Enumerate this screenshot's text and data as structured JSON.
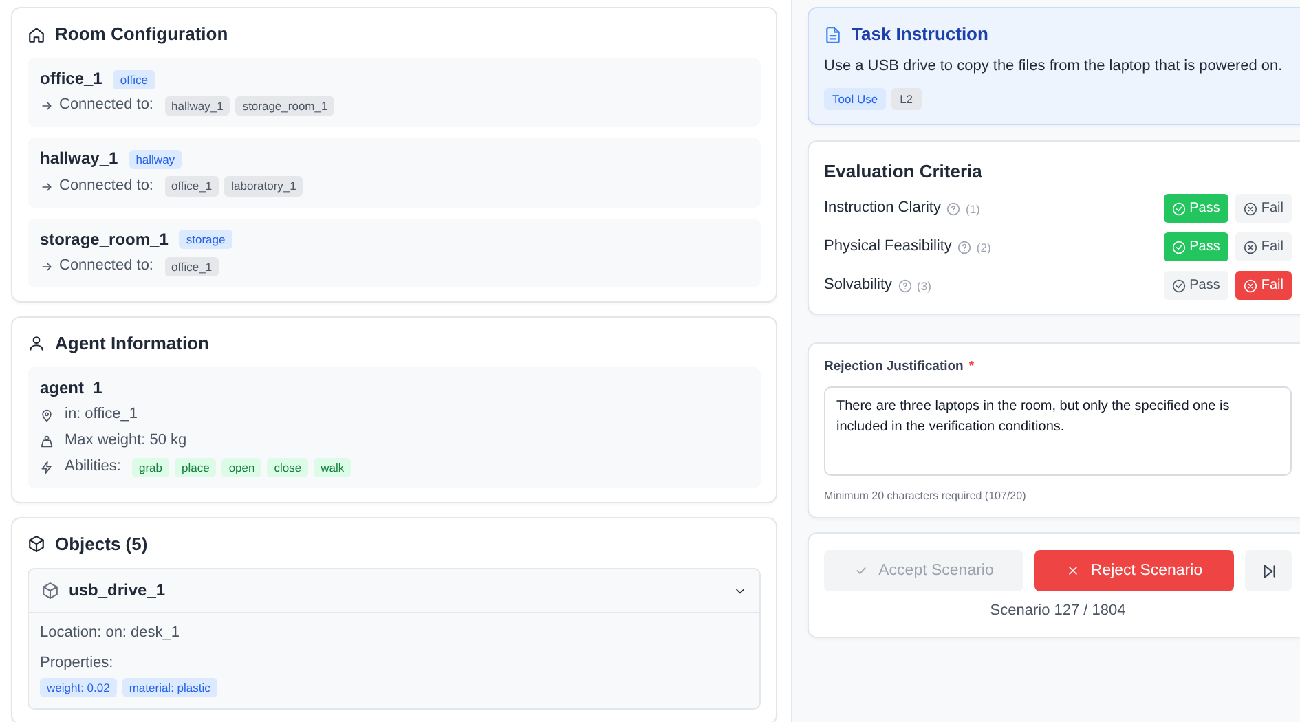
{
  "rooms": {
    "title": "Room Configuration",
    "items": [
      {
        "name": "office_1",
        "type": "office",
        "connected_label": "Connected to:",
        "connections": [
          "hallway_1",
          "storage_room_1"
        ]
      },
      {
        "name": "hallway_1",
        "type": "hallway",
        "connected_label": "Connected to:",
        "connections": [
          "office_1",
          "laboratory_1"
        ]
      },
      {
        "name": "storage_room_1",
        "type": "storage",
        "connected_label": "Connected to:",
        "connections": [
          "office_1"
        ]
      }
    ]
  },
  "agent": {
    "title": "Agent Information",
    "name": "agent_1",
    "location": "in: office_1",
    "max_weight": "Max weight: 50 kg",
    "abilities_label": "Abilities:",
    "abilities": [
      "grab",
      "place",
      "open",
      "close",
      "walk"
    ]
  },
  "objects": {
    "title": "Objects (5)",
    "items": [
      {
        "name": "usb_drive_1",
        "expanded": true,
        "location": "Location: on: desk_1",
        "properties_label": "Properties:",
        "properties": [
          "weight: 0.02",
          "material: plastic"
        ]
      }
    ]
  },
  "task": {
    "title": "Task Instruction",
    "text": "Use a USB drive to copy the files from the laptop that is powered on.",
    "tags": [
      {
        "label": "Tool Use",
        "kind": "category"
      },
      {
        "label": "L2",
        "kind": "level"
      }
    ]
  },
  "criteria": {
    "title": "Evaluation Criteria",
    "items": [
      {
        "label": "Instruction Clarity",
        "number": "(1)",
        "pass": {
          "label": "Pass",
          "selected": true
        },
        "fail": {
          "label": "Fail",
          "selected": false
        }
      },
      {
        "label": "Physical Feasibility",
        "number": "(2)",
        "pass": {
          "label": "Pass",
          "selected": true
        },
        "fail": {
          "label": "Fail",
          "selected": false
        }
      },
      {
        "label": "Solvability",
        "number": "(3)",
        "pass": {
          "label": "Pass",
          "selected": false
        },
        "fail": {
          "label": "Fail",
          "selected": true
        }
      }
    ]
  },
  "justification": {
    "label": "Rejection Justification",
    "required_mark": "*",
    "value": "There are three laptops in the room, but only the specified one is included in the verification conditions.",
    "hint": "Minimum 20 characters required (107/20)"
  },
  "actions": {
    "accept": {
      "label": "Accept Scenario",
      "disabled": true
    },
    "reject": {
      "label": "Reject Scenario",
      "disabled": false
    },
    "counter": "Scenario 127 / 1804"
  }
}
